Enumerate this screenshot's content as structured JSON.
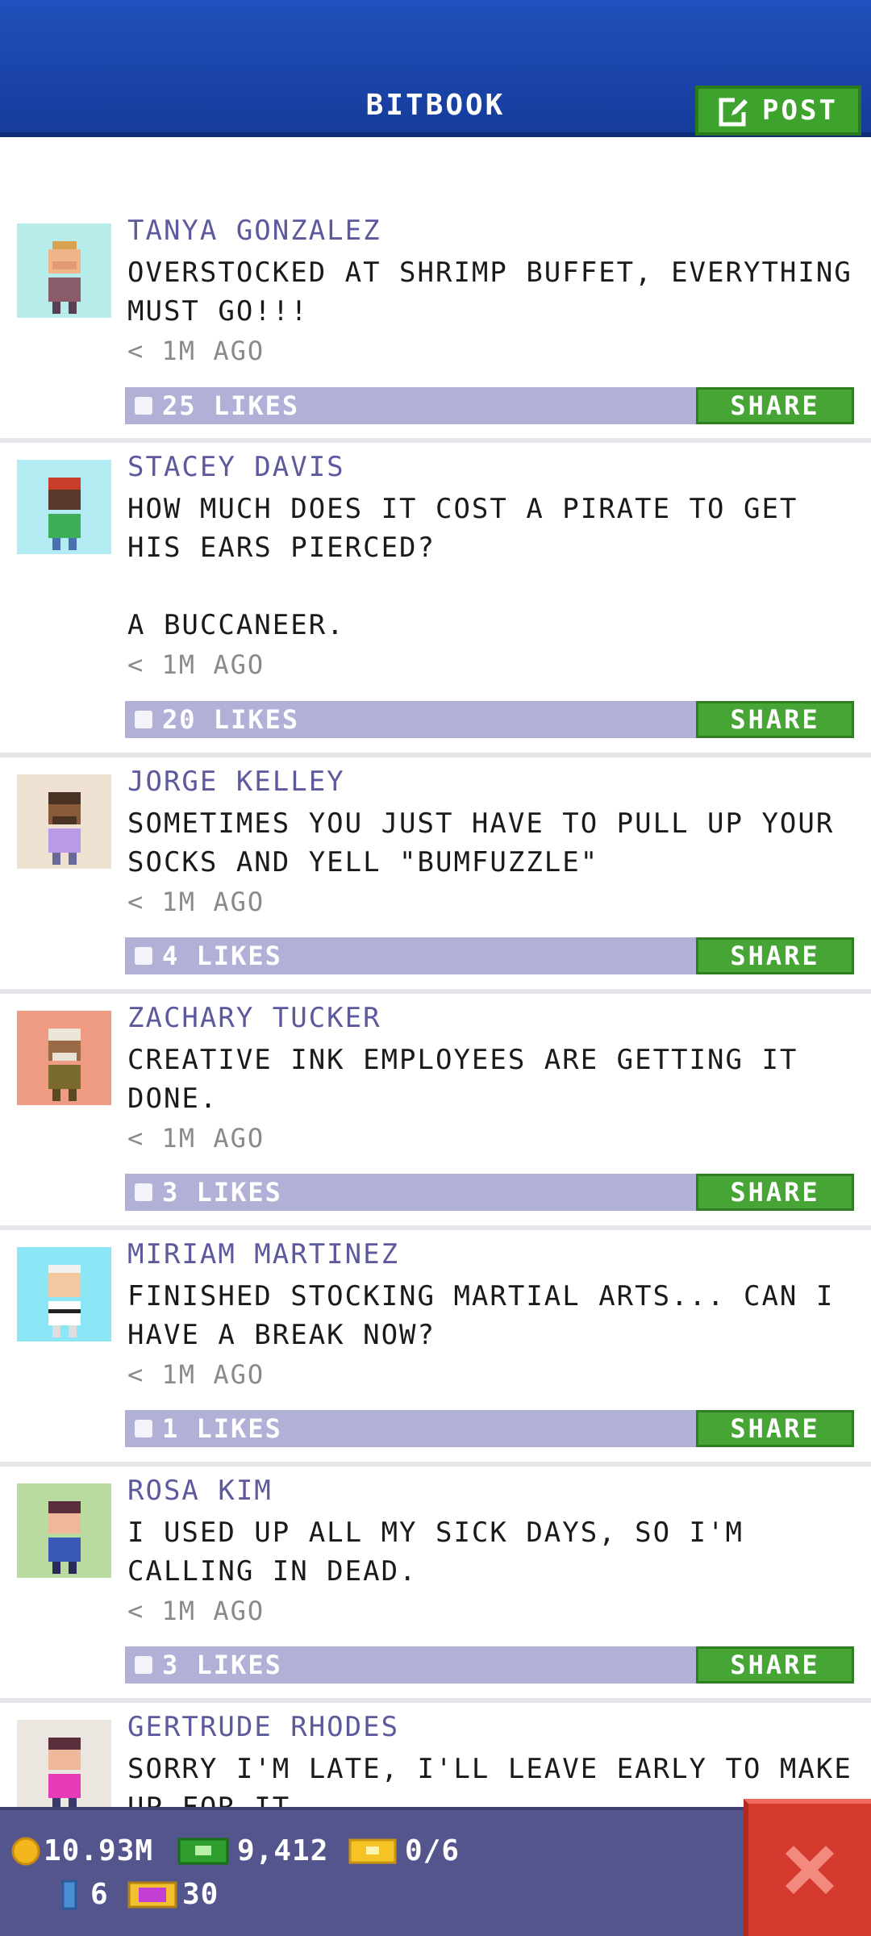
{
  "header": {
    "title": "BITBOOK",
    "post_label": "POST"
  },
  "posts": [
    {
      "name": "TANYA GONZALEZ",
      "message": "OVERSTOCKED AT SHRIMP BUFFET, EVERYTHING MUST GO!!!",
      "time": "< 1M AGO",
      "likes": "25 LIKES",
      "share": "SHARE",
      "avatar_color": "#b7ecea"
    },
    {
      "name": "STACEY DAVIS",
      "message": "HOW MUCH DOES IT COST A PIRATE TO GET HIS EARS PIERCED?\n\nA BUCCANEER.",
      "time": "< 1M AGO",
      "likes": "20 LIKES",
      "share": "SHARE",
      "avatar_color": "#b2ecf2"
    },
    {
      "name": "JORGE KELLEY",
      "message": "SOMETIMES YOU JUST HAVE TO PULL UP YOUR SOCKS AND YELL \"BUMFUZZLE\"",
      "time": "< 1M AGO",
      "likes": "4 LIKES",
      "share": "SHARE",
      "avatar_color": "#efe1d2"
    },
    {
      "name": "ZACHARY TUCKER",
      "message": "CREATIVE INK EMPLOYEES ARE GETTING IT DONE.",
      "time": "< 1M AGO",
      "likes": "3 LIKES",
      "share": "SHARE",
      "avatar_color": "#ee9b84"
    },
    {
      "name": "MIRIAM MARTINEZ",
      "message": "FINISHED STOCKING MARTIAL ARTS... CAN I HAVE A BREAK NOW?",
      "time": "< 1M AGO",
      "likes": "1 LIKES",
      "share": "SHARE",
      "avatar_color": "#8be7f5"
    },
    {
      "name": "ROSA KIM",
      "message": "I USED UP ALL MY SICK DAYS, SO I'M CALLING IN DEAD.",
      "time": "< 1M AGO",
      "likes": "3 LIKES",
      "share": "SHARE",
      "avatar_color": "#b9dba0"
    },
    {
      "name": "GERTRUDE RHODES",
      "message": "SORRY I'M LATE, I'LL LEAVE EARLY TO MAKE UP FOR IT.",
      "time": "",
      "likes": "",
      "share": "",
      "avatar_color": "#ece6e0"
    }
  ],
  "bottom": {
    "coins": "10.93M",
    "bux": "9,412",
    "tickets": "0/6",
    "keys": "6",
    "vip": "30"
  },
  "colors": {
    "accent_blue": "#1a45ab",
    "green": "#47a536",
    "likes_bar": "#b1b1d8",
    "bottom_bar": "#55558e",
    "close_red": "#d63a2e"
  }
}
